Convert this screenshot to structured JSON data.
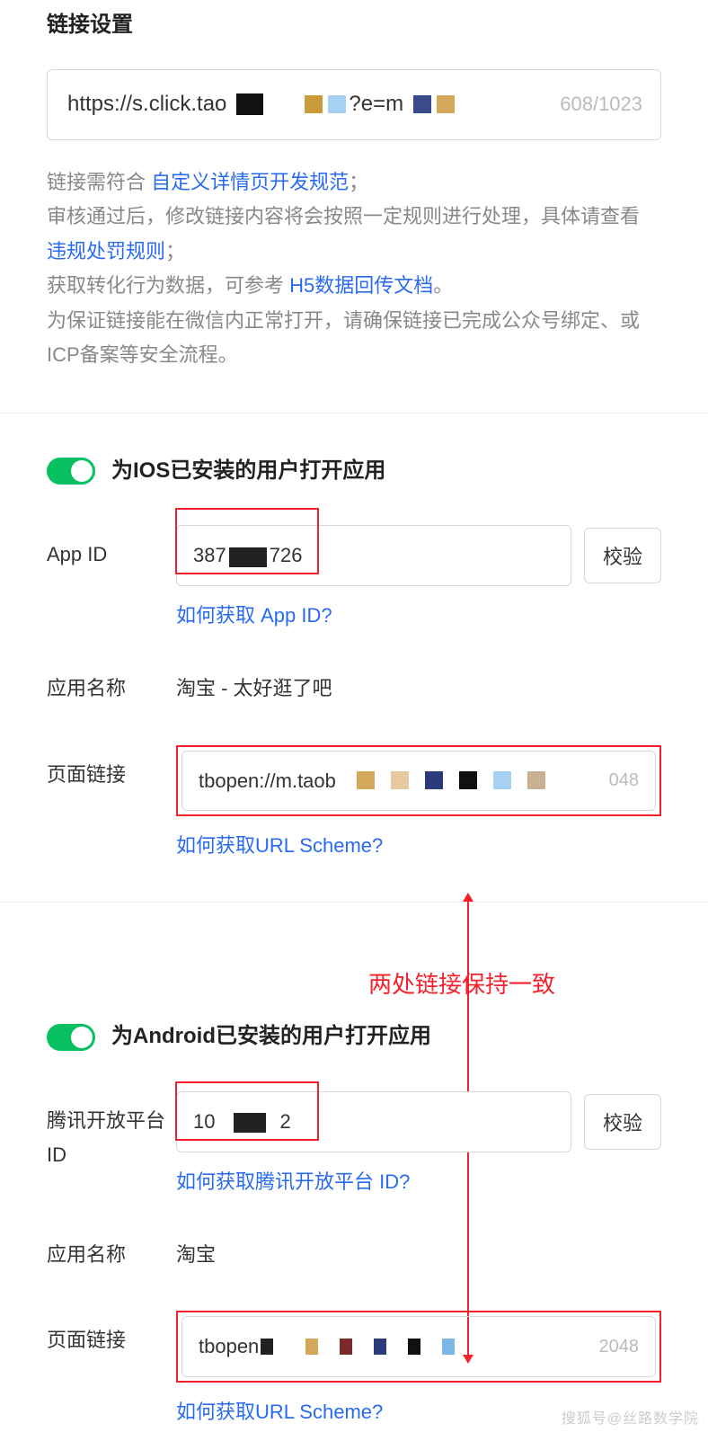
{
  "link_settings": {
    "title": "链接设置",
    "url_value": "https://s.click.tao",
    "url_value_suffix": "?e=m",
    "counter": "608/1023",
    "help_line1_prefix": "链接需符合 ",
    "help_link1": "自定义详情页开发规范",
    "help_line1_suffix": "；",
    "help_line2": "审核通过后，修改链接内容将会按照一定规则进行处理，具体请查看 ",
    "help_link2": "违规处罚规则",
    "help_line2_suffix": "；",
    "help_line3": "获取转化行为数据，可参考 ",
    "help_link3": "H5数据回传文档",
    "help_line3_suffix": "。",
    "help_line4": "为保证链接能在微信内正常打开，请确保链接已完成公众号绑定、或ICP备案等安全流程。"
  },
  "ios": {
    "toggle_label": "为IOS已安装的用户打开应用",
    "app_id_label": "App ID",
    "app_id_value_pre": "387",
    "app_id_value_post": "726",
    "verify_btn": "校验",
    "app_id_hint": "如何获取 App ID?",
    "app_name_label": "应用名称",
    "app_name_value": "淘宝 - 太好逛了吧",
    "page_link_label": "页面链接",
    "page_link_value": "tbopen://m.taob",
    "page_link_counter": "048",
    "page_link_hint": "如何获取URL Scheme?"
  },
  "annotation": {
    "text": "两处链接保持一致"
  },
  "android": {
    "toggle_label": "为Android已安装的用户打开应用",
    "tencent_id_label": "腾讯开放平台 ID",
    "tencent_id_value_pre": "10",
    "tencent_id_value_post": "2",
    "verify_btn": "校验",
    "tencent_id_hint": "如何获取腾讯开放平台 ID?",
    "app_name_label": "应用名称",
    "app_name_value": "淘宝",
    "page_link_label": "页面链接",
    "page_link_value": "tbopen",
    "page_link_counter": "2048",
    "page_link_hint": "如何获取URL Scheme?"
  },
  "watermark": "搜狐号@丝路数学院"
}
